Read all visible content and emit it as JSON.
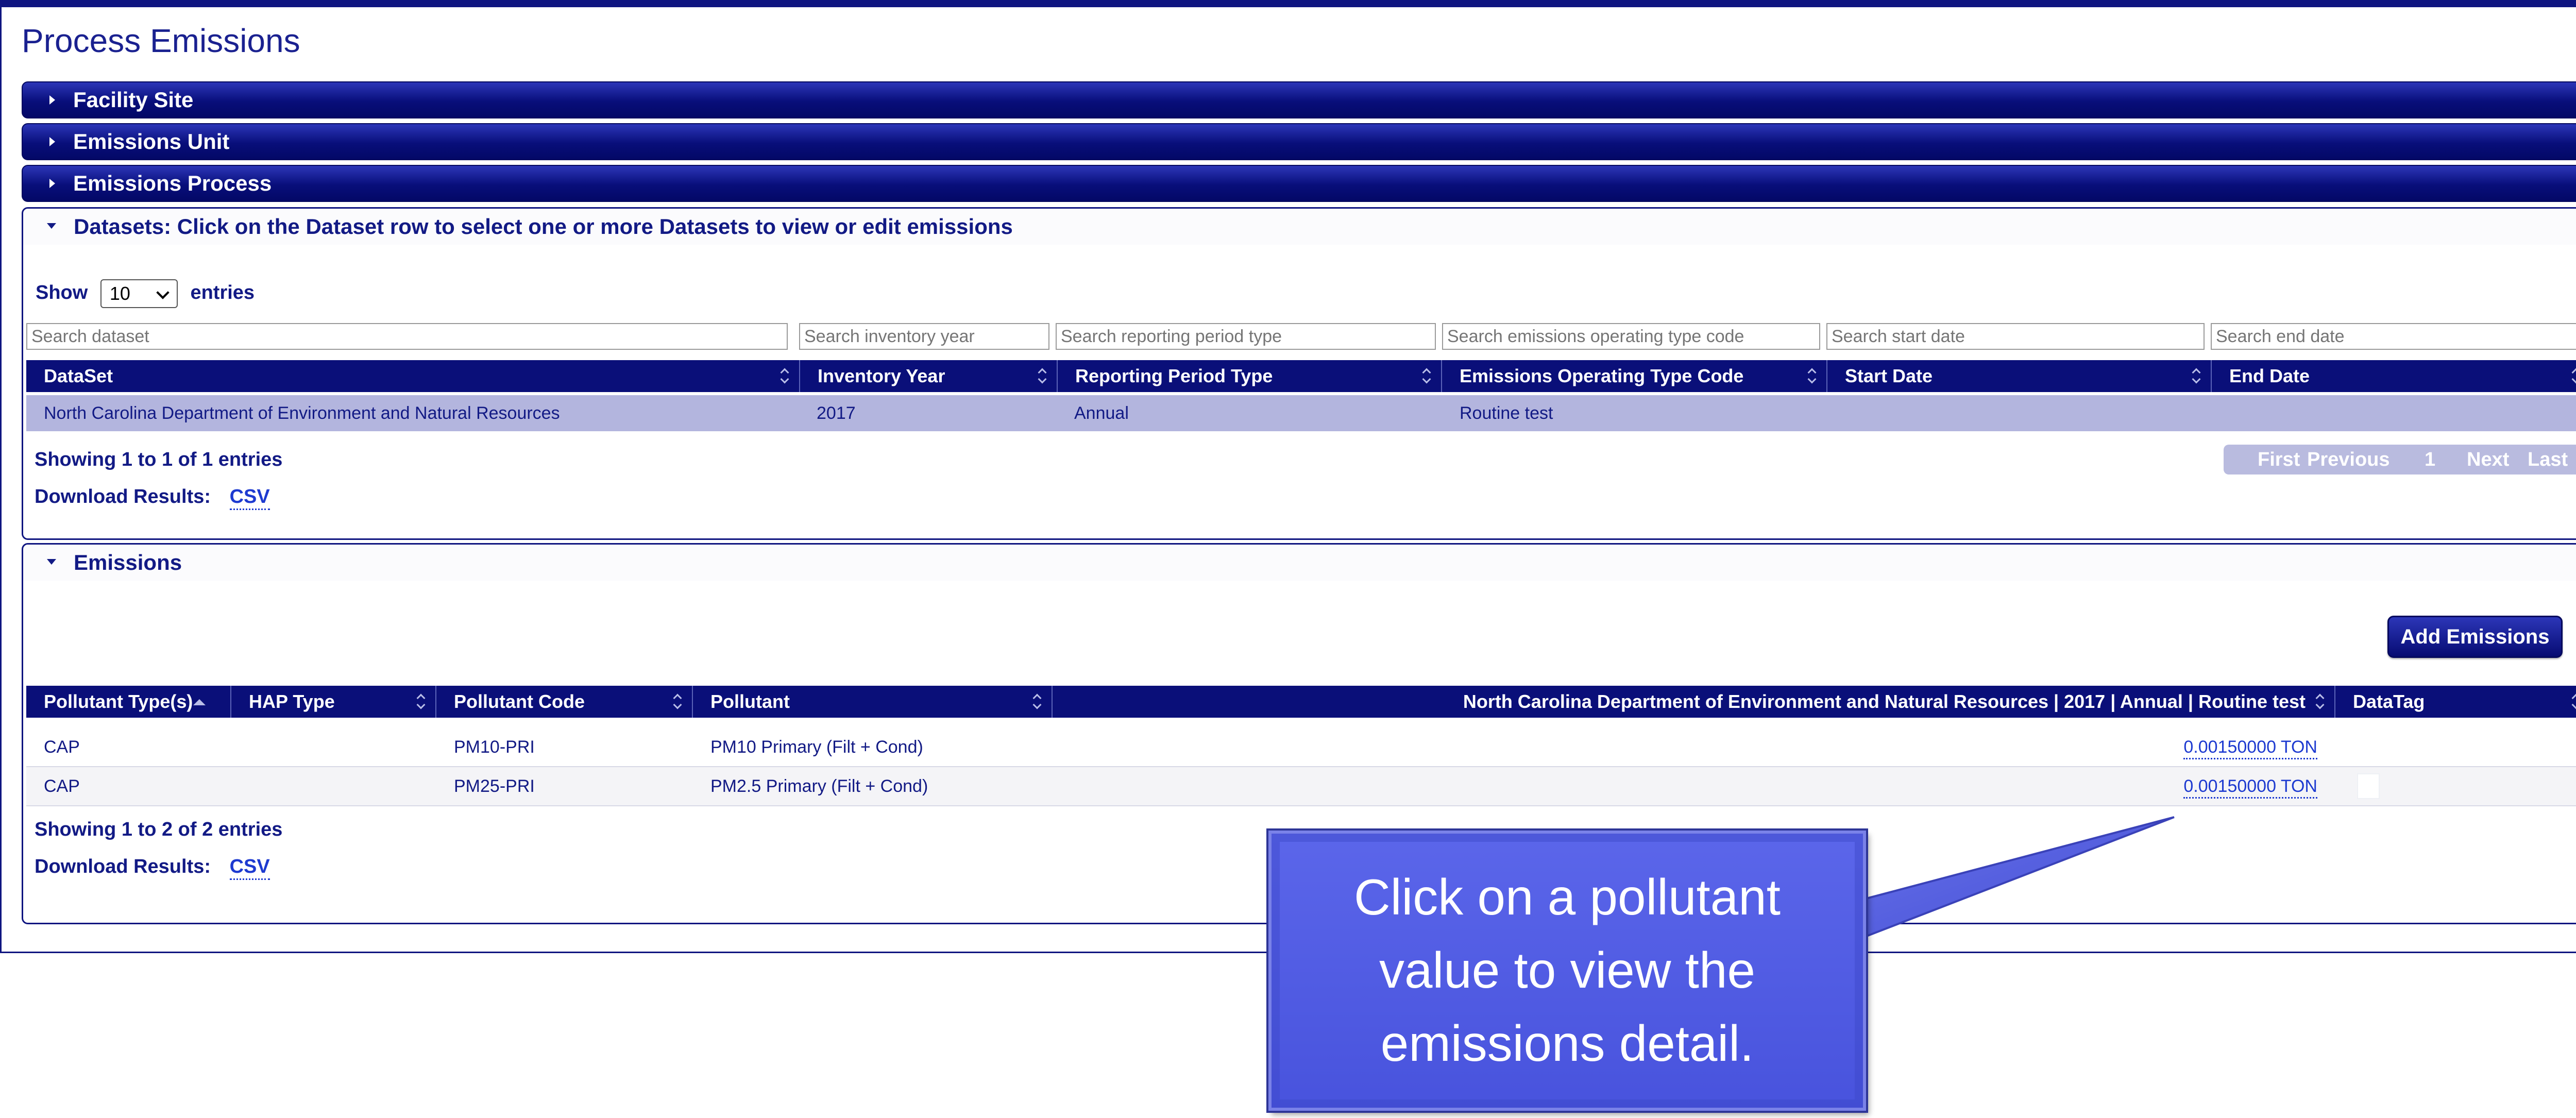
{
  "page": {
    "title": "Process Emissions"
  },
  "accordions": {
    "facility_site": "Facility Site",
    "emissions_unit": "Emissions Unit",
    "emissions_process": "Emissions Process"
  },
  "datasets": {
    "header": "Datasets: Click on the Dataset row to select one or more Datasets to view or edit emissions",
    "show_label": "Show",
    "entries_label": "entries",
    "page_length": "10",
    "search_placeholders": {
      "dataset": "Search dataset",
      "inventory_year": "Search inventory year",
      "reporting_period_type": "Search reporting period type",
      "operating_type_code": "Search emissions operating type code",
      "start_date": "Search start date",
      "end_date": "Search end date"
    },
    "columns": [
      "DataSet",
      "Inventory Year",
      "Reporting Period Type",
      "Emissions Operating Type Code",
      "Start Date",
      "End Date"
    ],
    "rows": [
      {
        "dataset": "North Carolina Department of Environment and Natural Resources",
        "inventory_year": "2017",
        "reporting_period_type": "Annual",
        "operating_type_code": "Routine test",
        "start_date": "",
        "end_date": ""
      }
    ],
    "info": "Showing 1 to 1 of 1 entries",
    "download_label": "Download Results:",
    "download_csv": "CSV",
    "pager": {
      "first": "First",
      "previous": "Previous",
      "current": "1",
      "next": "Next",
      "last": "Last"
    }
  },
  "emissions": {
    "header": "Emissions",
    "add_button": "Add Emissions",
    "columns": [
      "Pollutant Type(s)",
      "HAP Type",
      "Pollutant Code",
      "Pollutant",
      "North Carolina Department of Environment and Natural Resources | 2017 | Annual | Routine test",
      "DataTag"
    ],
    "rows": [
      {
        "type": "CAP",
        "hap": "",
        "code": "PM10-PRI",
        "pollutant": "PM10 Primary (Filt + Cond)",
        "value": "0.00150000 TON",
        "datatag": ""
      },
      {
        "type": "CAP",
        "hap": "",
        "code": "PM25-PRI",
        "pollutant": "PM2.5 Primary (Filt + Cond)",
        "value": "0.00150000 TON",
        "datatag": ""
      }
    ],
    "info": "Showing 1 to 2 of 2 entries",
    "download_label": "Download Results:",
    "download_csv": "CSV"
  },
  "callout": {
    "line1": "Click on a pollutant",
    "line2": "value to view the",
    "line3": "emissions detail."
  },
  "colors": {
    "primary": "#0a0f79",
    "selected_row": "#b3b5de",
    "callout": "#5059e2",
    "link": "#1d3ad0"
  }
}
